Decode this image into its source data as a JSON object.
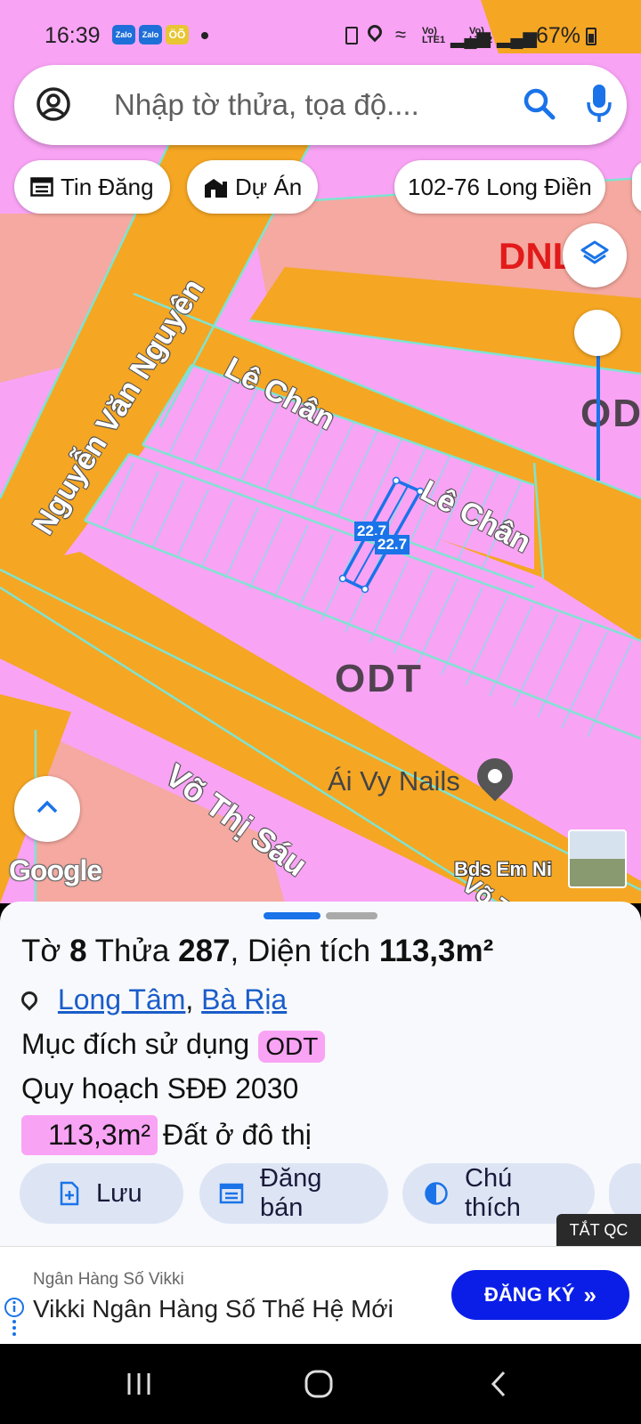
{
  "status_bar": {
    "time": "16:39",
    "apps": [
      "Zalo",
      "Zalo",
      "ÖÕ"
    ],
    "network_1": "Vo)\nLTE1",
    "network_2": "Vo)\nLTE2",
    "battery": "67%"
  },
  "search": {
    "placeholder": "Nhập tờ thửa, tọa độ...."
  },
  "chips": [
    {
      "label": "Tin Đăng",
      "icon": "listing-icon"
    },
    {
      "label": "Dự Án",
      "icon": "building-icon"
    },
    {
      "label": "102-76 Long Điền"
    }
  ],
  "map": {
    "roads": [
      "Nguyễn Văn Nguyên",
      "Lê Chân",
      "Lê Chân",
      "Võ Thị Sáu",
      "Võ T"
    ],
    "zones": [
      "ODT",
      "ODT",
      "DNL"
    ],
    "measurements": [
      "22.7",
      "22.7"
    ],
    "poi": "Ái Vy Nails",
    "attribution": "Google",
    "street_view_label": "Bds Em Ni",
    "colors": {
      "residential": "#f9a3f5",
      "road": "#f5a623",
      "commercial": "#f5a9a0",
      "boundary": "#7fe3d0",
      "selection": "#1a73e8"
    }
  },
  "parcel": {
    "sheet_label": "Tờ",
    "sheet_no": "8",
    "lot_label": "Thửa",
    "lot_no": "287",
    "area_label": "Diện tích",
    "area_value": "113,3m²",
    "ward": "Long Tâm",
    "city": "Bà Rịa",
    "purpose_label": "Mục đích sử dụng",
    "purpose_code": "ODT",
    "plan_label": "Quy hoạch SĐĐ 2030",
    "plan_area": "113,3m²",
    "plan_use": "Đất ở đô thị"
  },
  "actions": [
    {
      "label": "Lưu",
      "icon": "add-file-icon"
    },
    {
      "label": "Đăng bán",
      "icon": "post-listing-icon"
    },
    {
      "label": "Chú thích",
      "icon": "legend-icon"
    }
  ],
  "ad": {
    "toggle": "TẮT QC",
    "sponsor": "Ngân Hàng Số Vikki",
    "headline": "Vikki Ngân Hàng Số Thế Hệ Mới",
    "cta": "ĐĂNG KÝ"
  }
}
